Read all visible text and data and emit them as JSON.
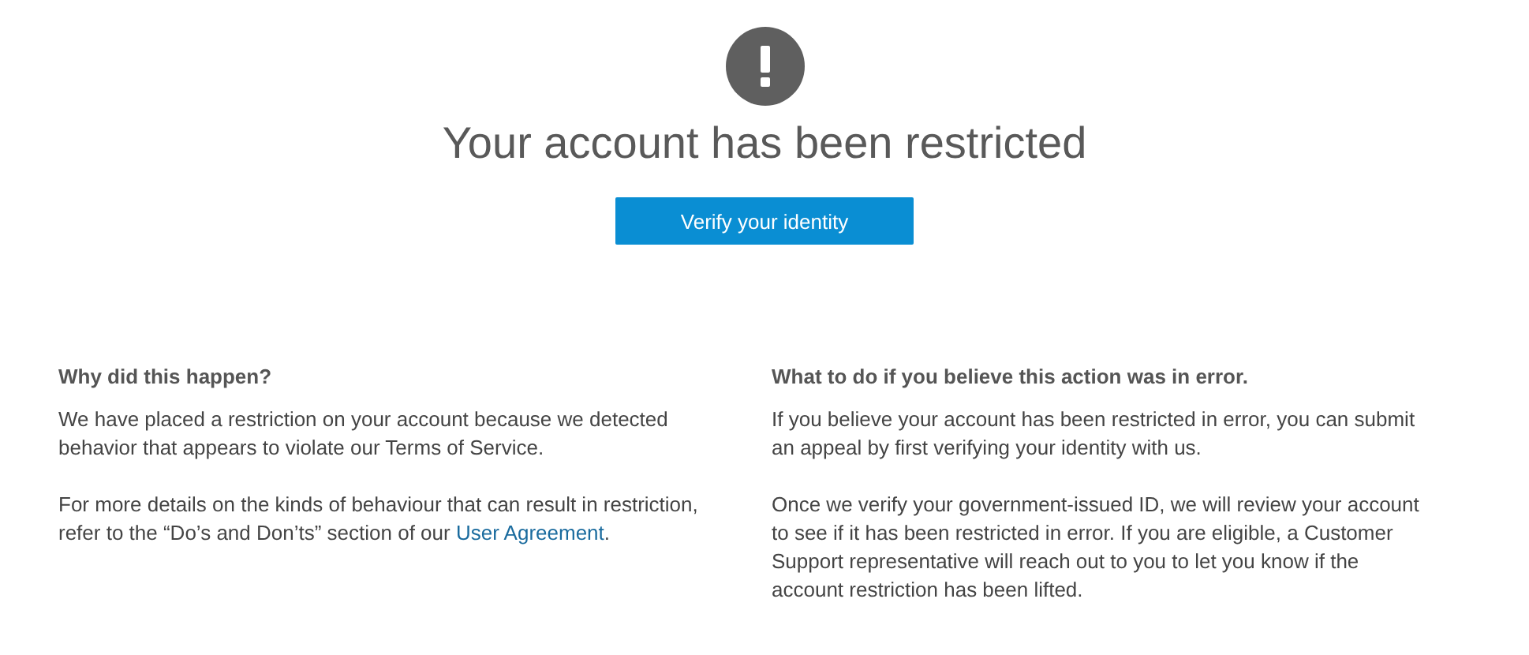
{
  "title": "Your account has been restricted",
  "button": "Verify your identity",
  "sections": [
    {
      "heading": "Why did this happen?",
      "paragraphs": [
        {
          "text": "We have placed a restriction on your account because we detected behavior that appears to violate our Terms of Service."
        },
        {
          "text": "For more details on the kinds of behaviour that can result in restriction, refer to the “Do’s and Don’ts” section of our ",
          "link": "User Agreement",
          "after": "."
        }
      ]
    },
    {
      "heading": "What to do if you believe this action was in error.",
      "paragraphs": [
        {
          "text": "If you believe your account has been restricted in error, you can submit an appeal by first verifying your identity with us."
        },
        {
          "text": "Once we verify your government-issued ID, we will review your account to see if it has been restricted in error. If you are eligible, a Customer Support representative will reach out to you to let you know if the account restriction has been lifted."
        }
      ]
    }
  ]
}
